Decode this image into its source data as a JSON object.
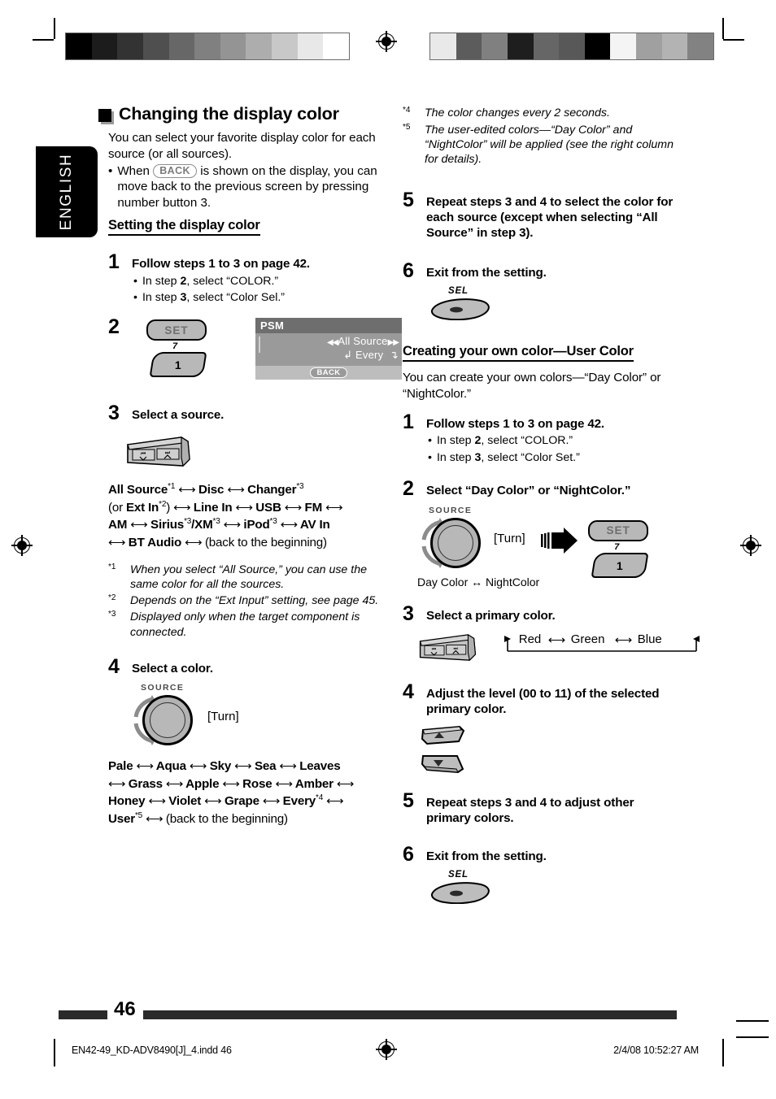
{
  "meta": {
    "language_tab": "ENGLISH",
    "page_number": "46",
    "footer_left": "EN42-49_KD-ADV8490[J]_4.indd   46",
    "footer_right": "2/4/08   10:52:27 AM"
  },
  "calibration": {
    "left_strip": [
      "#000000",
      "#1c1c1c",
      "#333333",
      "#4f4f4f",
      "#676767",
      "#808080",
      "#949494",
      "#adadad",
      "#c8c8c8",
      "#e8e8e8",
      "#ffffff"
    ],
    "right_strip": [
      "#e9e9e9",
      "#5c5c5c",
      "#808080",
      "#1e1e1e",
      "#666666",
      "#585858",
      "#000000",
      "#f4f4f4",
      "#a0a0a0",
      "#b3b3b3",
      "#828282"
    ]
  },
  "left_column": {
    "heading": "Changing the display color",
    "intro": "You can select your favorite display color for each source (or all sources).",
    "intro_bullet": {
      "pre": "When",
      "pill": "BACK",
      "post": "is shown on the display, you can move back to the previous screen by pressing number button 3."
    },
    "section_heading": "Setting the display color",
    "step1": {
      "num": "1",
      "text": "Follow steps 1 to 3 on page 42.",
      "subs": [
        {
          "pre": "In step ",
          "bold": "2",
          "post": ", select “COLOR.”"
        },
        {
          "pre": "In step ",
          "bold": "3",
          "post": ", select “Color Sel.”"
        }
      ]
    },
    "step2": {
      "num": "2",
      "set_label": "SET",
      "tick_label": "7",
      "num_button": "1",
      "psm": {
        "title": "PSM",
        "line1": "All   Source",
        "line2": "Every",
        "back": "BACK"
      }
    },
    "step3": {
      "num": "3",
      "text": "Select a source.",
      "chain_lines": [
        "All Source*1 ↔ Disc ↔ Changer*3",
        "(or Ext In*2) ↔ Line In ↔ USB ↔ FM ↔",
        "AM ↔ Sirius*3/XM*3 ↔ iPod*3 ↔ AV In",
        "↔ BT Audio ↔ (back to the beginning)"
      ],
      "footnotes": [
        {
          "mark": "*1",
          "text": "When you select “All Source,” you can use the same color for all the sources."
        },
        {
          "mark": "*2",
          "text": "Depends on the “Ext Input” setting, see page 45."
        },
        {
          "mark": "*3",
          "text": "Displayed only when the target component is connected."
        }
      ]
    },
    "step4": {
      "num": "4",
      "text": "Select a color.",
      "dial_label": "SOURCE",
      "turn_label": "[Turn]",
      "color_lines": [
        "Pale ↔ Aqua ↔ Sky ↔ Sea ↔ Leaves",
        "↔ Grass ↔ Apple ↔ Rose ↔ Amber ↔",
        "Honey ↔ Violet ↔ Grape ↔ Every*4 ↔",
        "User*5 ↔ (back to the beginning)"
      ]
    }
  },
  "right_column": {
    "footnotes": [
      {
        "mark": "*4",
        "text": "The color changes every 2 seconds."
      },
      {
        "mark": "*5",
        "text": "The user-edited colors—“Day Color” and “NightColor” will be applied (see the right column for details)."
      }
    ],
    "step5": {
      "num": "5",
      "text": "Repeat steps 3 and 4 to select the color for each source (except when selecting “All Source” in step 3)."
    },
    "step6": {
      "num": "6",
      "text": "Exit from the setting.",
      "sel_label": "SEL"
    },
    "section_heading": "Creating your own color—User Color",
    "section_intro": "You can create your own colors—“Day Color” or “NightColor.”",
    "step1": {
      "num": "1",
      "text": "Follow steps 1 to 3 on page 42.",
      "subs": [
        {
          "pre": "In step ",
          "bold": "2",
          "post": ", select “COLOR.”"
        },
        {
          "pre": "In step ",
          "bold": "3",
          "post": ", select “Color Set.”"
        }
      ]
    },
    "step2": {
      "num": "2",
      "text": "Select “Day Color” or “NightColor.”",
      "dial_label": "SOURCE",
      "turn_label": "[Turn]",
      "toggle_label": "Day Color ↔ NightColor",
      "set_label": "SET",
      "tick_label": "7",
      "num_button": "1"
    },
    "step3": {
      "num": "3",
      "text": "Select a primary color.",
      "primaries": [
        "Red",
        "Green",
        "Blue"
      ]
    },
    "step4": {
      "num": "4",
      "text": "Adjust the level (00 to 11) of the selected primary color."
    },
    "step5b": {
      "num": "5",
      "text": "Repeat steps 3 and 4 to adjust other primary colors."
    },
    "step6b": {
      "num": "6",
      "text": "Exit from the setting.",
      "sel_label": "SEL"
    }
  }
}
